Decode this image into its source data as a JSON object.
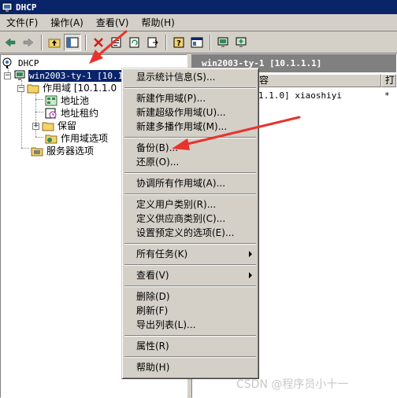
{
  "window": {
    "title": "DHCP"
  },
  "menubar": {
    "items": [
      "文件(F)",
      "操作(A)",
      "查看(V)",
      "帮助(H)"
    ]
  },
  "toolbar": {
    "buttons": [
      "back-arrow-icon",
      "forward-arrow-icon",
      "up-folder-icon",
      "show-hide-tree-icon",
      "delete-icon",
      "properties-icon",
      "refresh-icon",
      "export-list-icon",
      "help-icon",
      "console-icon",
      "authorize-server-icon",
      "add-server-icon"
    ]
  },
  "tree": {
    "root": "DHCP",
    "server": "win2003-ty-1 [10.1.1",
    "scope": "作用域 [10.1.1.0",
    "address_pool": "地址池",
    "address_leases": "地址租约",
    "reservations": "保留",
    "scope_options": "作用域选项",
    "server_options": "服务器选项"
  },
  "right_pane": {
    "header": "win2003-ty-1 [10.1.1.1]",
    "columns": [
      "容",
      "打"
    ],
    "rows": [
      {
        "scope": "1.1.0] xiaoshiyi",
        "flag": "*"
      }
    ]
  },
  "context_menu": {
    "items": [
      "显示统计信息(S)...",
      "新建作用域(P)...",
      "新建超级作用域(U)...",
      "新建多播作用域(M)...",
      "备份(B)...",
      "还原(O)...",
      "协调所有作用域(A)...",
      "定义用户类别(R)...",
      "定义供应商类别(C)...",
      "设置预定义的选项(E)...",
      "所有任务(K)",
      "查看(V)",
      "删除(D)",
      "刷新(F)",
      "导出列表(L)...",
      "属性(R)",
      "帮助(H)"
    ]
  },
  "colors": {
    "selection": "#0a246a",
    "annotation_arrow": "#e8332c",
    "window_face": "#d4d0c8"
  },
  "watermark": "CSDN @程序员小十一"
}
